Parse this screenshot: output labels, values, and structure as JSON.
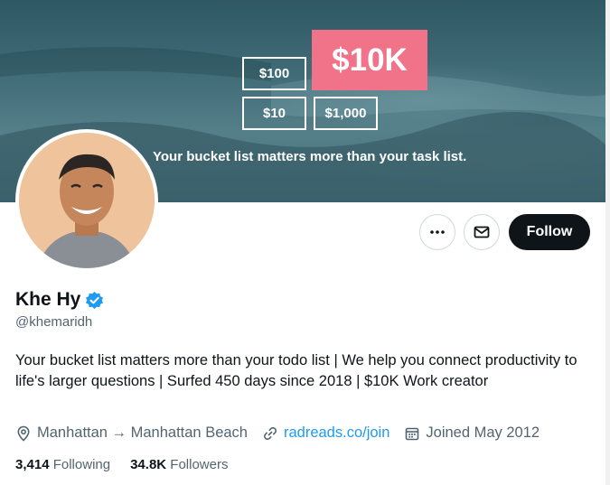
{
  "banner": {
    "prices": [
      "$100",
      "$10K",
      "$10",
      "$1,000"
    ],
    "tagline": "Your bucket list matters more than your task list."
  },
  "actions": {
    "more_icon": "more-horizontal-icon",
    "message_icon": "envelope-icon",
    "follow_label": "Follow"
  },
  "profile": {
    "name": "Khe Hy",
    "verified_icon": "verified-badge-icon",
    "handle": "@khemaridh",
    "bio": "Your bucket list matters more than your todo list  | We help you connect productivity to life's larger questions  | Surfed 450 days since 2018  | $10K Work creator",
    "location": "Manhattan → Manhattan Beach",
    "website": "radreads.co/join",
    "joined": "Joined May 2012"
  },
  "stats": {
    "following_count": "3,414",
    "following_label": "Following",
    "followers_count": "34.8K",
    "followers_label": "Followers"
  },
  "colors": {
    "accent": "#1d9bf0",
    "price_highlight": "#f0738a",
    "follow_bg": "#0f1419"
  }
}
